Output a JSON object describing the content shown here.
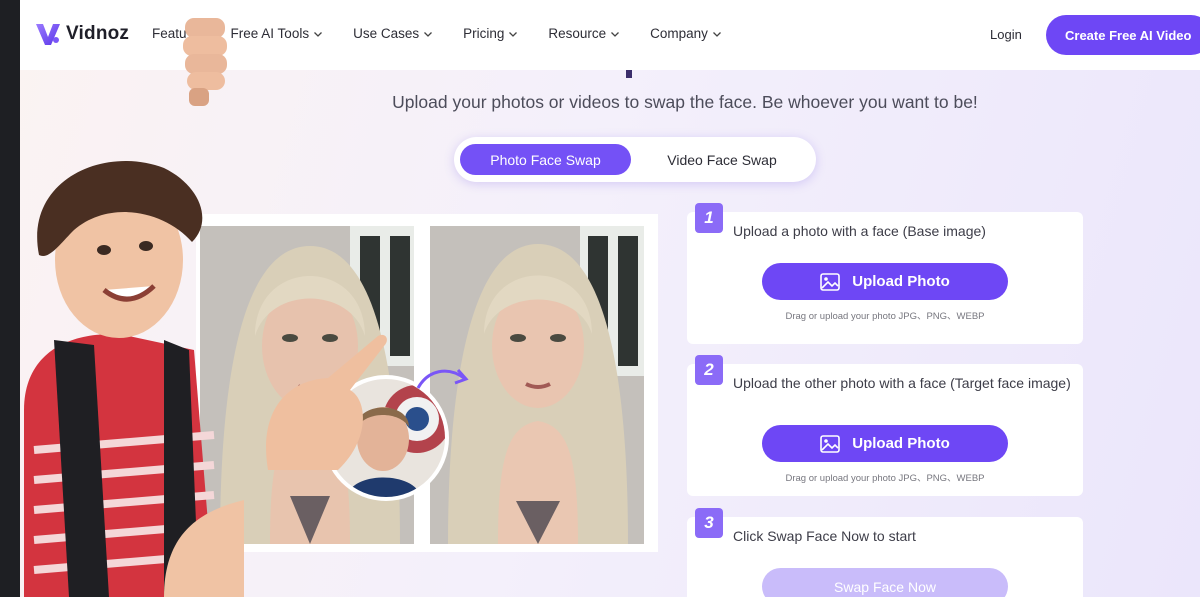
{
  "brand": {
    "name": "Vidnoz",
    "accent": "#6e47f5"
  },
  "nav": {
    "items": [
      {
        "label": "Featu",
        "chevron": "chevron-down-icon"
      },
      {
        "label": "Free AI Tools",
        "chevron": "chevron-down-icon"
      },
      {
        "label": "Use Cases",
        "chevron": "chevron-down-icon"
      },
      {
        "label": "Pricing",
        "chevron": "chevron-down-icon"
      },
      {
        "label": "Resource",
        "chevron": "chevron-down-icon"
      },
      {
        "label": "Company",
        "chevron": "chevron-down-icon"
      }
    ],
    "login": "Login",
    "cta": "Create Free AI Video"
  },
  "hero": {
    "subtitle": "Upload your photos or videos to swap the face. Be whoever you want to be!"
  },
  "tabs": {
    "active": "Photo Face Swap",
    "inactive": "Video Face Swap"
  },
  "steps": [
    {
      "number": "1",
      "text": "Upload a photo with a face (Base image)",
      "button": "Upload Photo",
      "hint": "Drag or upload your photo JPG、PNG、WEBP"
    },
    {
      "number": "2",
      "text": "Upload the other photo with a face (Target face image)",
      "button": "Upload Photo",
      "hint": "Drag or upload your photo JPG、PNG、WEBP"
    },
    {
      "number": "3",
      "text": "Click Swap Face Now to start",
      "button": "Swap Face Now"
    }
  ]
}
